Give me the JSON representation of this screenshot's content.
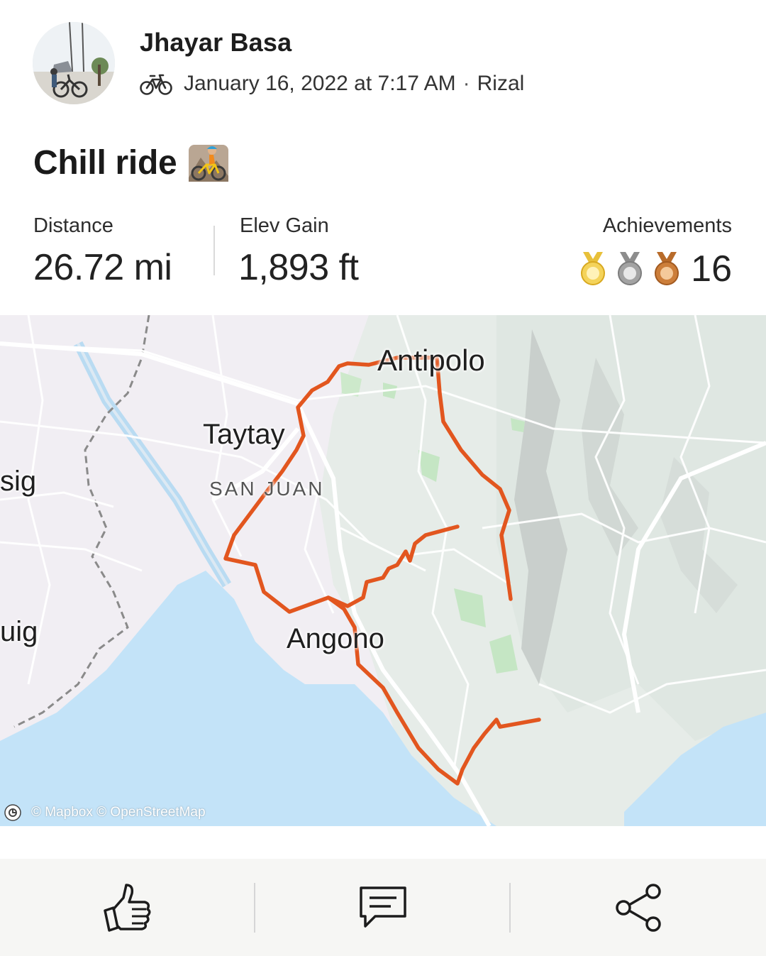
{
  "activity": {
    "athlete_name": "Jhayar Basa",
    "date": "January 16, 2022 at 7:17 AM",
    "separator": "·",
    "location": "Rizal",
    "sport_icon": "bike-icon",
    "title": "Chill ride",
    "title_emoji": "person-mountain-biking-emoji"
  },
  "stats": {
    "distance": {
      "label": "Distance",
      "value": "26.72 mi"
    },
    "elevation": {
      "label": "Elev Gain",
      "value": "1,893 ft"
    },
    "achievements": {
      "label": "Achievements",
      "count": "16",
      "medals": [
        "gold-medal-icon",
        "silver-medal-icon",
        "bronze-medal-icon"
      ]
    }
  },
  "map": {
    "labels": {
      "antipolo": "Antipolo",
      "taytay": "Taytay",
      "san_juan": "SAN JUAN",
      "angono": "Angono",
      "pasig_partial": "sig",
      "taguig_partial": "uig"
    },
    "attribution": "© Mapbox © OpenStreetMap",
    "route_color": "#e2561f",
    "water_color": "#c3e3f8"
  },
  "actions": {
    "kudos": "thumbs-up-icon",
    "comment": "comment-icon",
    "share": "share-icon"
  }
}
